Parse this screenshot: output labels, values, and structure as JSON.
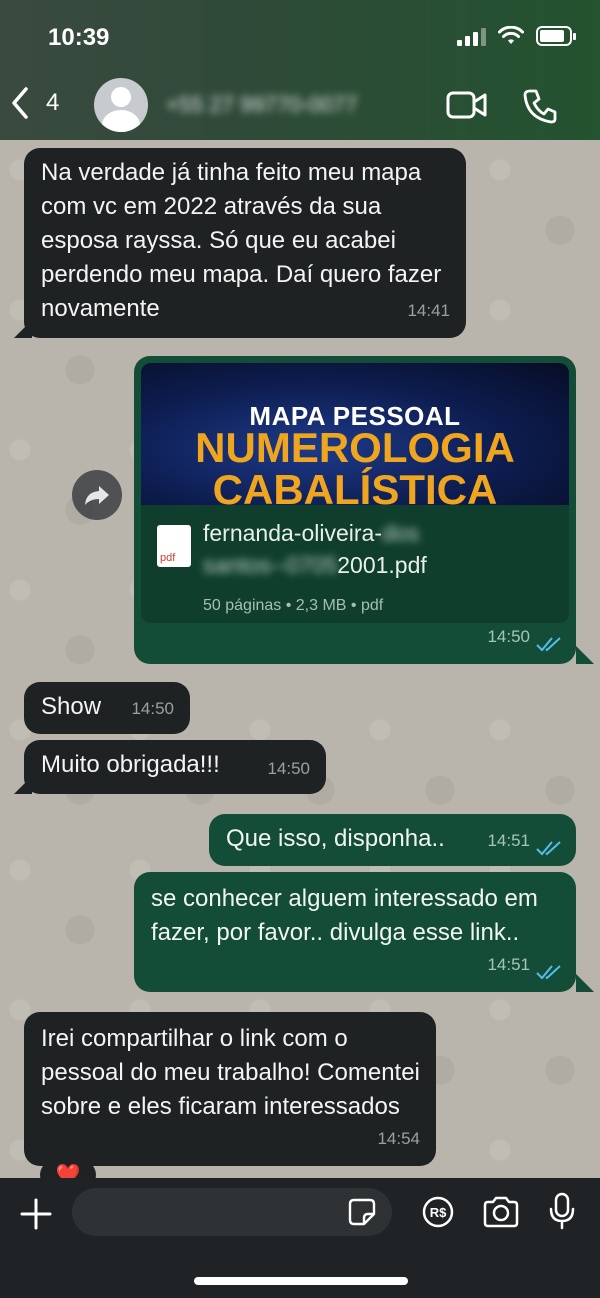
{
  "status": {
    "time": "10:39"
  },
  "header": {
    "back_count": "4",
    "contact_name": "+55 27 99770-0077"
  },
  "messages": [
    {
      "dir": "in",
      "text": "Na verdade já tinha feito meu mapa com vc em 2022 através da sua esposa rayssa. Só que eu acabei perdendo meu mapa. Daí quero fazer novamente",
      "time": "14:41"
    },
    {
      "dir": "out",
      "type": "document",
      "time": "14:50",
      "banner_line1": "MAPA PESSOAL",
      "banner_line2": "NUMEROLOGIA",
      "banner_line3": "CABALÍSTICA",
      "icon_label": "pdf",
      "file_name_a": "fernanda-oliveira-",
      "file_name_blur1": "dos",
      "file_name_blur2": "santos--0705",
      "file_name_b": "2001.pdf",
      "meta": "50 páginas • 2,3 MB • pdf"
    },
    {
      "dir": "in",
      "text": "Show",
      "time": "14:50"
    },
    {
      "dir": "in",
      "text": "Muito obrigada!!!",
      "time": "14:50"
    },
    {
      "dir": "out",
      "text": "Que isso, disponha..",
      "time": "14:51"
    },
    {
      "dir": "out",
      "text": "se conhecer alguem interessado em fazer, por favor.. divulga esse link..",
      "time": "14:51"
    },
    {
      "dir": "in",
      "text": "Irei compartilhar o link com o pessoal do meu trabalho! Comentei sobre e eles ficaram interessados",
      "time": "14:54"
    }
  ],
  "reaction": "❤️",
  "icons": {
    "back": "chevron-left-icon",
    "video": "video-camera-icon",
    "call": "phone-icon",
    "add": "plus-icon",
    "sticker": "sticker-icon",
    "payment": "real-currency-icon",
    "camera": "camera-icon",
    "mic": "microphone-icon",
    "forward": "forward-icon"
  },
  "colors": {
    "incoming_bubble": "#1f2223",
    "outgoing_bubble": "#144d37",
    "read_ticks": "#53bdeb"
  }
}
